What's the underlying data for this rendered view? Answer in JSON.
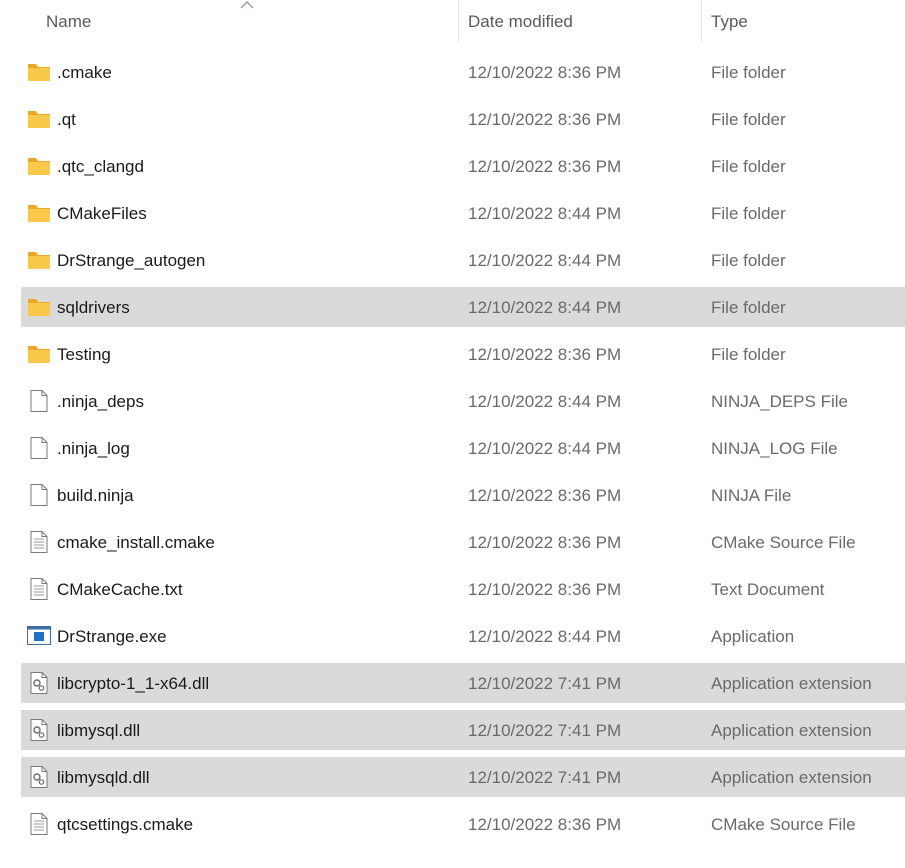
{
  "columns": {
    "name": "Name",
    "date": "Date modified",
    "type": "Type"
  },
  "colors": {
    "selected_row": "#dadada",
    "folder": "#f8c94a"
  },
  "files": [
    {
      "name": ".cmake",
      "date": "12/10/2022 8:36 PM",
      "type": "File folder",
      "icon": "folder-icon",
      "selected": false
    },
    {
      "name": ".qt",
      "date": "12/10/2022 8:36 PM",
      "type": "File folder",
      "icon": "folder-icon",
      "selected": false
    },
    {
      "name": ".qtc_clangd",
      "date": "12/10/2022 8:36 PM",
      "type": "File folder",
      "icon": "folder-icon",
      "selected": false
    },
    {
      "name": "CMakeFiles",
      "date": "12/10/2022 8:44 PM",
      "type": "File folder",
      "icon": "folder-icon",
      "selected": false
    },
    {
      "name": "DrStrange_autogen",
      "date": "12/10/2022 8:44 PM",
      "type": "File folder",
      "icon": "folder-icon",
      "selected": false
    },
    {
      "name": "sqldrivers",
      "date": "12/10/2022 8:44 PM",
      "type": "File folder",
      "icon": "folder-icon",
      "selected": true
    },
    {
      "name": "Testing",
      "date": "12/10/2022 8:36 PM",
      "type": "File folder",
      "icon": "folder-icon",
      "selected": false
    },
    {
      "name": ".ninja_deps",
      "date": "12/10/2022 8:44 PM",
      "type": "NINJA_DEPS File",
      "icon": "blank-file-icon",
      "selected": false
    },
    {
      "name": ".ninja_log",
      "date": "12/10/2022 8:44 PM",
      "type": "NINJA_LOG File",
      "icon": "blank-file-icon",
      "selected": false
    },
    {
      "name": "build.ninja",
      "date": "12/10/2022 8:36 PM",
      "type": "NINJA File",
      "icon": "blank-file-icon",
      "selected": false
    },
    {
      "name": "cmake_install.cmake",
      "date": "12/10/2022 8:36 PM",
      "type": "CMake Source File",
      "icon": "text-file-icon",
      "selected": false
    },
    {
      "name": "CMakeCache.txt",
      "date": "12/10/2022 8:36 PM",
      "type": "Text Document",
      "icon": "text-file-icon",
      "selected": false
    },
    {
      "name": "DrStrange.exe",
      "date": "12/10/2022 8:44 PM",
      "type": "Application",
      "icon": "application-icon",
      "selected": false
    },
    {
      "name": "libcrypto-1_1-x64.dll",
      "date": "12/10/2022 7:41 PM",
      "type": "Application extension",
      "icon": "dll-file-icon",
      "selected": true
    },
    {
      "name": "libmysql.dll",
      "date": "12/10/2022 7:41 PM",
      "type": "Application extension",
      "icon": "dll-file-icon",
      "selected": true
    },
    {
      "name": "libmysqld.dll",
      "date": "12/10/2022 7:41 PM",
      "type": "Application extension",
      "icon": "dll-file-icon",
      "selected": true
    },
    {
      "name": "qtcsettings.cmake",
      "date": "12/10/2022 8:36 PM",
      "type": "CMake Source File",
      "icon": "text-file-icon",
      "selected": false
    }
  ]
}
